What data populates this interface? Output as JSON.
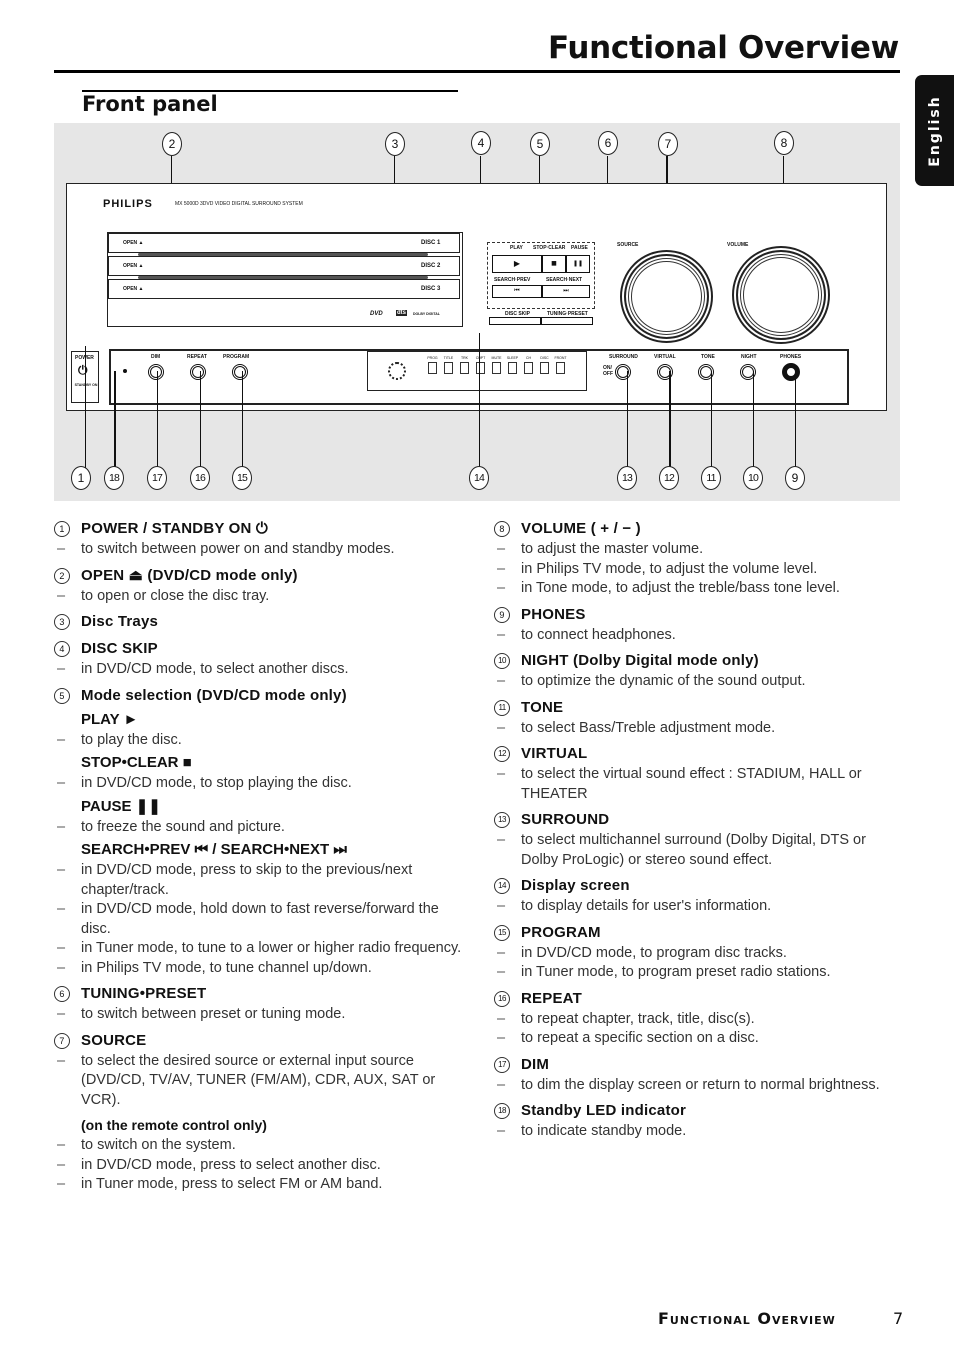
{
  "header": {
    "page_title": "Functional Overview",
    "language_tab": "English",
    "section_title": "Front panel"
  },
  "figure": {
    "callouts_top": [
      "2",
      "3",
      "4",
      "5",
      "6",
      "7",
      "8"
    ],
    "callouts_bottom": [
      "1",
      "18",
      "17",
      "16",
      "15",
      "14",
      "13",
      "12",
      "11",
      "10",
      "9"
    ],
    "device": {
      "brand": "PHILIPS",
      "model_line": "MX 5000D  3DVD VIDEO DIGITAL SURROUND SYSTEM",
      "trays": [
        {
          "open_label": "OPEN ▲",
          "disc_label": "DISC 1"
        },
        {
          "open_label": "OPEN ▲",
          "disc_label": "DISC 2"
        },
        {
          "open_label": "OPEN ▲",
          "disc_label": "DISC 3"
        }
      ],
      "logos": [
        "DVD",
        "dts",
        "DOLBY DIGITAL"
      ],
      "transport": {
        "play_label": "PLAY",
        "stop_label": "STOP·CLEAR",
        "pause_label": "PAUSE",
        "play_icon": "▶",
        "stop_icon": "■",
        "pause_icon": "❚❚",
        "search_prev_label": "SEARCH·PREV",
        "search_next_label": "SEARCH·NEXT",
        "prev_icon": "⏮",
        "next_icon": "⏭",
        "disc_skip_label": "DISC SKIP",
        "tuning_preset_label": "TUNING·PRESET"
      },
      "knobs": {
        "source_label": "SOURCE",
        "volume_label": "VOLUME"
      },
      "power": {
        "label": "POWER",
        "icon": "⏻",
        "standby_label": "STANDBY ON"
      },
      "left_buttons": [
        "DIM",
        "REPEAT",
        "PROGRAM"
      ],
      "right_buttons": [
        "SURROUND",
        "VIRTUAL",
        "TONE",
        "NIGHT",
        "PHONES"
      ],
      "surround_onoff": "ON/ OFF",
      "display_segments": [
        "PROG",
        "TITLE",
        "TRK",
        "CHPT",
        "MUTE",
        "SLEEP",
        "CH",
        "DISC",
        "FRONT"
      ]
    }
  },
  "left_column": [
    {
      "num": "1",
      "title": "POWER / STANDBY ON ⏻",
      "lines": [
        "to switch between power on and standby modes."
      ]
    },
    {
      "num": "2",
      "title": "OPEN ⏏ (DVD/CD mode only)",
      "lines": [
        "to open or close the disc tray."
      ]
    },
    {
      "num": "3",
      "title": "Disc Trays",
      "lines": []
    },
    {
      "num": "4",
      "title": "DISC SKIP",
      "lines": [
        "in DVD/CD mode, to select another discs."
      ]
    },
    {
      "num": "5",
      "title": "Mode selection (DVD/CD mode only)",
      "subs": [
        {
          "title": "PLAY ►",
          "lines": [
            "to play the disc."
          ]
        },
        {
          "title": "STOP•CLEAR ■",
          "lines": [
            "in DVD/CD mode, to stop playing the disc."
          ]
        },
        {
          "title": "PAUSE ❚❚",
          "lines": [
            "to freeze the sound and picture."
          ]
        },
        {
          "title": "SEARCH•PREV ⏮ / SEARCH•NEXT ⏭",
          "lines": [
            "in DVD/CD mode, press to skip to the previous/next chapter/track.",
            "in DVD/CD mode, hold down to fast reverse/forward the disc.",
            "in Tuner mode, to tune to a lower or higher radio frequency.",
            "in Philips TV mode, to tune channel up/down."
          ]
        }
      ]
    },
    {
      "num": "6",
      "title": "TUNING•PRESET",
      "lines": [
        "to switch between preset or tuning mode."
      ]
    },
    {
      "num": "7",
      "title": "SOURCE",
      "lines": [
        "to select the desired source or external input source (DVD/CD, TV/AV, TUNER (FM/AM), CDR, AUX, SAT or VCR)."
      ],
      "note": "(on the remote control only)",
      "note_lines": [
        "to switch on the system.",
        "in DVD/CD mode, press to select another disc.",
        "in Tuner mode, press to select FM or AM band."
      ]
    }
  ],
  "right_column": [
    {
      "num": "8",
      "title": "VOLUME ( + / − )",
      "lines": [
        "to adjust the master volume.",
        "in Philips TV mode, to adjust the volume level.",
        "in Tone mode, to adjust the treble/bass tone level."
      ]
    },
    {
      "num": "9",
      "title": "PHONES",
      "lines": [
        "to connect headphones."
      ]
    },
    {
      "num": "10",
      "title": "NIGHT (Dolby Digital mode only)",
      "lines": [
        "to optimize the dynamic of the sound output."
      ]
    },
    {
      "num": "11",
      "title": "TONE",
      "lines": [
        "to select Bass/Treble adjustment mode."
      ]
    },
    {
      "num": "12",
      "title": "VIRTUAL",
      "lines": [
        "to select the virtual sound effect : STADIUM, HALL or THEATER"
      ]
    },
    {
      "num": "13",
      "title": "SURROUND",
      "lines": [
        "to select multichannel surround (Dolby Digital, DTS or Dolby ProLogic) or stereo sound effect."
      ]
    },
    {
      "num": "14",
      "title": "Display screen",
      "lines": [
        "to display details for user's information."
      ]
    },
    {
      "num": "15",
      "title": "PROGRAM",
      "lines": [
        "in DVD/CD mode, to program disc tracks.",
        "in Tuner mode, to program preset radio stations."
      ]
    },
    {
      "num": "16",
      "title": "REPEAT",
      "lines": [
        "to repeat chapter, track, title, disc(s).",
        "to repeat a specific section on a disc."
      ]
    },
    {
      "num": "17",
      "title": "DIM",
      "lines": [
        "to dim the display screen or return to normal brightness."
      ]
    },
    {
      "num": "18",
      "title": "Standby LED indicator",
      "lines": [
        "to indicate standby mode."
      ]
    }
  ],
  "footer": {
    "label": "Functional Overview",
    "page_number": "7"
  }
}
